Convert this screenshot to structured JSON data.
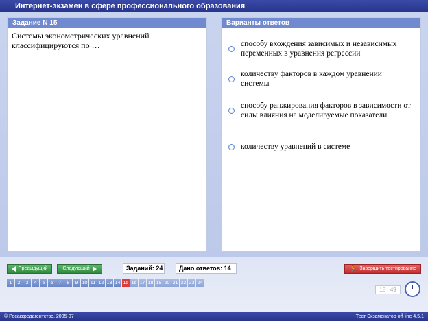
{
  "title": "Интернет-экзамен в сфере профессионального образования",
  "question_panel": {
    "header": "Задание N 15",
    "text": "Системы эконометрических уравнений классифицируются по …"
  },
  "answers_panel": {
    "header": "Варианты ответов",
    "options": [
      "способу вхождения зависимых и независимых переменных в уравнения регрессии",
      "количеству факторов в каждом уравнении системы",
      "способу ранжирования факторов в зависимости от силы влияния на моделируемые показатели",
      "количеству уравнений в системе"
    ]
  },
  "nav": {
    "prev_label": "Предыдущий",
    "next_label": "Следующий",
    "tasks_label": "Заданий: 24",
    "answered_label": "Дано ответов: 14",
    "finish_label": "Завершить тестирование",
    "pages": [
      "1",
      "2",
      "3",
      "4",
      "5",
      "6",
      "7",
      "8",
      "9",
      "10",
      "11",
      "12",
      "13",
      "14",
      "15",
      "16",
      "17",
      "18",
      "19",
      "20",
      "21",
      "22",
      "23",
      "24"
    ],
    "current_page": 15,
    "timer": "18 : 49"
  },
  "footer": {
    "left": "© Росаккредагентство, 2005-07",
    "right": "Тест Экзаменатор off-line 4.5.1"
  },
  "colors": {
    "title_bar": "#2f3e9a",
    "panel_header": "#7089cf",
    "nav_green": "#3a9a4a",
    "finish_red": "#d23c3c",
    "current_page": "#e03b3b"
  }
}
